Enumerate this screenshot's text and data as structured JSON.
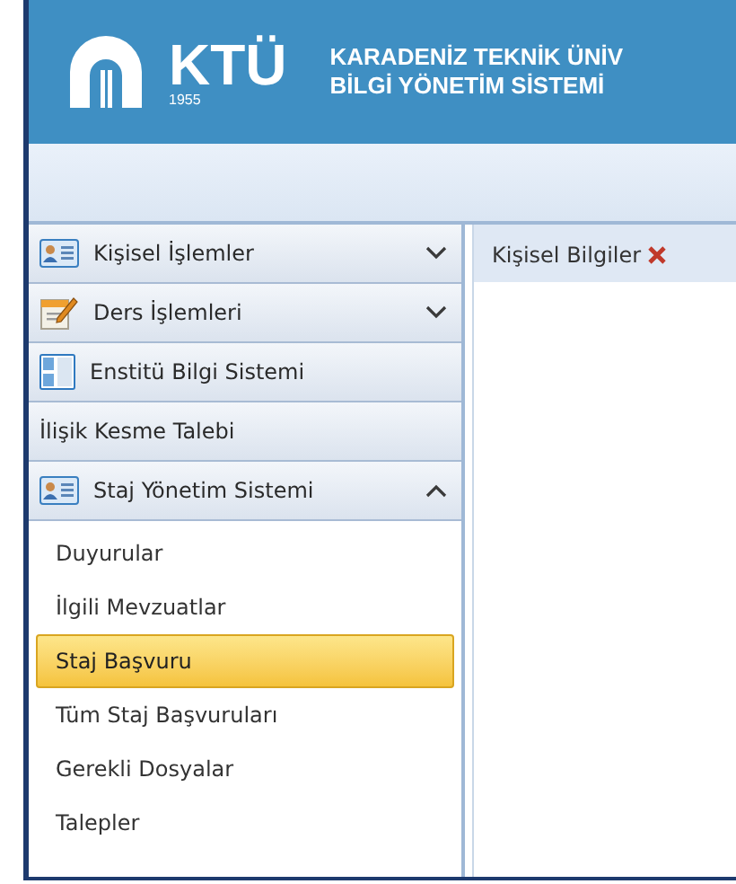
{
  "header": {
    "logo_text": "KTÜ",
    "logo_year": "1955",
    "title_line_1": "KARADENİZ TEKNİK ÜNİV",
    "title_line_2": "BİLGİ YÖNETİM SİSTEMİ"
  },
  "sidebar": {
    "groups": [
      {
        "label": "Kişisel İşlemler",
        "kind": "card",
        "expanded": false
      },
      {
        "label": "Ders İşlemleri",
        "kind": "form",
        "expanded": false
      },
      {
        "label": "Enstitü Bilgi Sistemi",
        "kind": "panel"
      },
      {
        "label": "İlişik Kesme Talebi",
        "kind": "plain"
      },
      {
        "label": "Staj Yönetim Sistemi",
        "kind": "card",
        "expanded": true,
        "children": [
          {
            "label": "Duyurular",
            "selected": false
          },
          {
            "label": "İlgili Mevzuatlar",
            "selected": false
          },
          {
            "label": "Staj Başvuru",
            "selected": true
          },
          {
            "label": "Tüm Staj Başvuruları",
            "selected": false
          },
          {
            "label": "Gerekli Dosyalar",
            "selected": false
          },
          {
            "label": "Talepler",
            "selected": false
          }
        ]
      }
    ]
  },
  "tabs": [
    {
      "label": "Kişisel Bilgiler",
      "closable": true
    }
  ]
}
